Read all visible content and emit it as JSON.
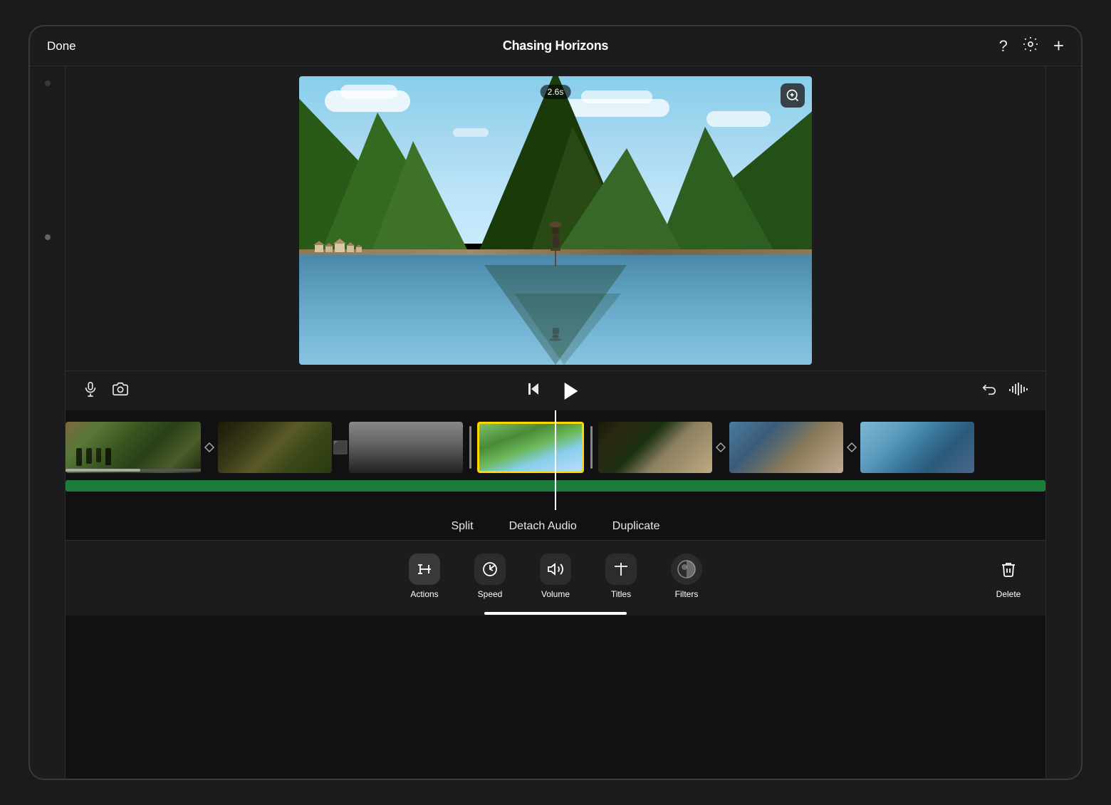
{
  "app": {
    "title": "Chasing Horizons",
    "done_label": "Done"
  },
  "header": {
    "title": "Chasing Horizons",
    "done": "Done",
    "help_icon": "?",
    "settings_icon": "⚙",
    "add_icon": "+"
  },
  "video_preview": {
    "timestamp": "2.6s",
    "zoom_icon": "zoom"
  },
  "playback": {
    "skip_back_icon": "skip-back",
    "play_icon": "play",
    "mic_icon": "microphone",
    "camera_icon": "camera",
    "undo_icon": "undo",
    "audio_wave_icon": "audio-wave"
  },
  "timeline": {
    "clips": [
      {
        "id": 1,
        "label": "clip-1",
        "type": "people-hiking",
        "selected": false
      },
      {
        "id": 2,
        "label": "clip-2",
        "type": "mountain-silhouette",
        "selected": false
      },
      {
        "id": 3,
        "label": "clip-3",
        "type": "foggy-peaks",
        "selected": false
      },
      {
        "id": 4,
        "label": "clip-4",
        "type": "green-hills",
        "selected": true
      },
      {
        "id": 5,
        "label": "clip-5",
        "type": "cliff-trees",
        "selected": false
      },
      {
        "id": 6,
        "label": "clip-6",
        "type": "rocky-peaks",
        "selected": false
      },
      {
        "id": 7,
        "label": "clip-7",
        "type": "river-boats",
        "selected": false
      }
    ]
  },
  "context_menu": {
    "split_label": "Split",
    "detach_audio_label": "Detach Audio",
    "duplicate_label": "Duplicate"
  },
  "toolbar": {
    "actions_label": "Actions",
    "speed_label": "Speed",
    "volume_label": "Volume",
    "titles_label": "Titles",
    "filters_label": "Filters",
    "delete_label": "Delete"
  }
}
